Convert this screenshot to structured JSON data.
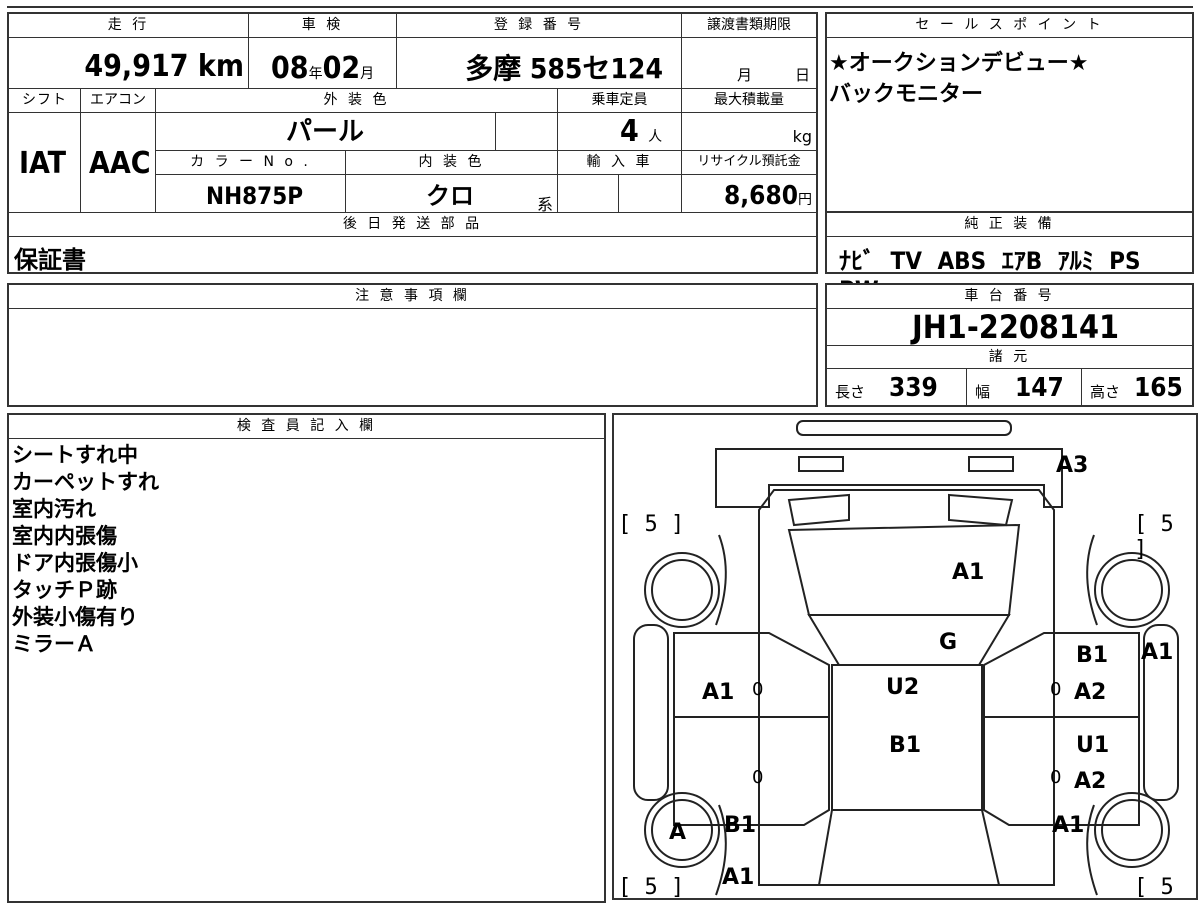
{
  "headers": {
    "mileage": "走 行",
    "shaken": "車 検",
    "registration": "登 録 番 号",
    "transfer_deadline": "譲渡書類期限",
    "sales_point": "セ ー ル ス ポ イ ン ト",
    "shift": "シフト",
    "aircon": "エアコン",
    "exterior_color": "外 装 色",
    "capacity": "乗車定員",
    "max_load": "最大積載量",
    "color_no": "カ ラ ー N o .",
    "interior_color": "内 装 色",
    "import": "輸 入 車",
    "recycle": "リサイクル預託金",
    "later_parts": "後 日 発 送 部 品",
    "genuine_equipment": "純 正 装 備",
    "notes": "注 意 事 項 欄",
    "chassis_no": "車 台 番 号",
    "specs": "諸 元",
    "inspector": "検 査 員 記 入 欄"
  },
  "values": {
    "mileage_num": "49,917",
    "mileage_unit": "km",
    "shaken_year": "08",
    "shaken_year_unit": "年",
    "shaken_month": "02",
    "shaken_month_unit": "月",
    "registration": "多摩 585セ124",
    "transfer_month": "月",
    "transfer_day": "日",
    "shift": "IAT",
    "aircon": "AAC",
    "exterior_color": "パール",
    "capacity": "4",
    "capacity_unit": "人",
    "max_load_unit": "kg",
    "color_no": "NH875P",
    "interior_color": "クロ",
    "interior_suffix": "系",
    "recycle": "8,680",
    "recycle_unit": "円",
    "later_parts": "保証書",
    "genuine_equipment": "ﾅﾋﾞ TV ABS ｴｱB ｱﾙﾐ PS PW",
    "chassis_no": "JH1-2208141",
    "length_label": "長さ",
    "length": "339",
    "width_label": "幅",
    "width": "147",
    "height_label": "高さ",
    "height": "165"
  },
  "sales_points": [
    "★オークションデビュー★",
    "バックモニター"
  ],
  "inspector_notes": [
    "シートすれ中",
    "カーペットすれ",
    "室内汚れ",
    "室内内張傷",
    "ドア内張傷小",
    "タッチＰ跡",
    "外装小傷有り",
    "ミラーＡ"
  ],
  "diagram": {
    "tire_tag": "[ 5 ]",
    "marks": {
      "rear_bumper": "A3",
      "trunk": "A1",
      "rear_glass": "G",
      "roof": "U2",
      "roof_front": "B1",
      "left_rear_door": "A1",
      "right_rear_quarter": "A1",
      "right_rear_door_b": "B1",
      "right_rear_door_a": "A2",
      "right_front_door_u": "U1",
      "right_front_door_a": "A2",
      "left_front_fender": "B1",
      "left_front_fender_a": "A1",
      "right_front_fender": "A1",
      "left_mirror": "A",
      "zero": "0"
    }
  }
}
